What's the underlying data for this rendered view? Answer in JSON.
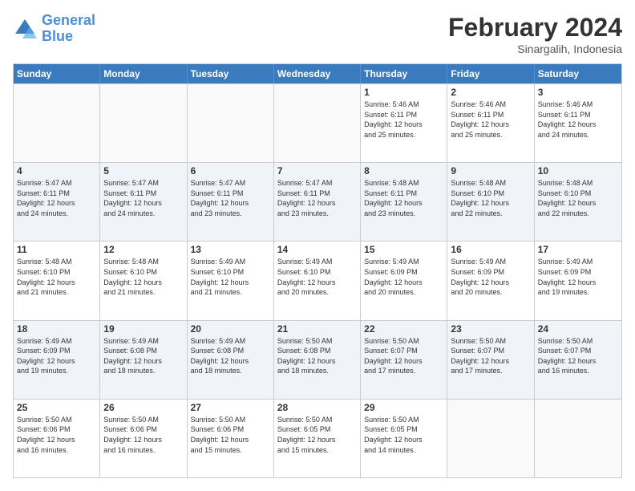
{
  "logo": {
    "text_general": "General",
    "text_blue": "Blue"
  },
  "header": {
    "month": "February 2024",
    "location": "Sinargalih, Indonesia"
  },
  "days_of_week": [
    "Sunday",
    "Monday",
    "Tuesday",
    "Wednesday",
    "Thursday",
    "Friday",
    "Saturday"
  ],
  "weeks": [
    {
      "alt": false,
      "cells": [
        {
          "day": "",
          "empty": true,
          "info": ""
        },
        {
          "day": "",
          "empty": true,
          "info": ""
        },
        {
          "day": "",
          "empty": true,
          "info": ""
        },
        {
          "day": "",
          "empty": true,
          "info": ""
        },
        {
          "day": "1",
          "empty": false,
          "info": "Sunrise: 5:46 AM\nSunset: 6:11 PM\nDaylight: 12 hours\nand 25 minutes."
        },
        {
          "day": "2",
          "empty": false,
          "info": "Sunrise: 5:46 AM\nSunset: 6:11 PM\nDaylight: 12 hours\nand 25 minutes."
        },
        {
          "day": "3",
          "empty": false,
          "info": "Sunrise: 5:46 AM\nSunset: 6:11 PM\nDaylight: 12 hours\nand 24 minutes."
        }
      ]
    },
    {
      "alt": true,
      "cells": [
        {
          "day": "4",
          "empty": false,
          "info": "Sunrise: 5:47 AM\nSunset: 6:11 PM\nDaylight: 12 hours\nand 24 minutes."
        },
        {
          "day": "5",
          "empty": false,
          "info": "Sunrise: 5:47 AM\nSunset: 6:11 PM\nDaylight: 12 hours\nand 24 minutes."
        },
        {
          "day": "6",
          "empty": false,
          "info": "Sunrise: 5:47 AM\nSunset: 6:11 PM\nDaylight: 12 hours\nand 23 minutes."
        },
        {
          "day": "7",
          "empty": false,
          "info": "Sunrise: 5:47 AM\nSunset: 6:11 PM\nDaylight: 12 hours\nand 23 minutes."
        },
        {
          "day": "8",
          "empty": false,
          "info": "Sunrise: 5:48 AM\nSunset: 6:11 PM\nDaylight: 12 hours\nand 23 minutes."
        },
        {
          "day": "9",
          "empty": false,
          "info": "Sunrise: 5:48 AM\nSunset: 6:10 PM\nDaylight: 12 hours\nand 22 minutes."
        },
        {
          "day": "10",
          "empty": false,
          "info": "Sunrise: 5:48 AM\nSunset: 6:10 PM\nDaylight: 12 hours\nand 22 minutes."
        }
      ]
    },
    {
      "alt": false,
      "cells": [
        {
          "day": "11",
          "empty": false,
          "info": "Sunrise: 5:48 AM\nSunset: 6:10 PM\nDaylight: 12 hours\nand 21 minutes."
        },
        {
          "day": "12",
          "empty": false,
          "info": "Sunrise: 5:48 AM\nSunset: 6:10 PM\nDaylight: 12 hours\nand 21 minutes."
        },
        {
          "day": "13",
          "empty": false,
          "info": "Sunrise: 5:49 AM\nSunset: 6:10 PM\nDaylight: 12 hours\nand 21 minutes."
        },
        {
          "day": "14",
          "empty": false,
          "info": "Sunrise: 5:49 AM\nSunset: 6:10 PM\nDaylight: 12 hours\nand 20 minutes."
        },
        {
          "day": "15",
          "empty": false,
          "info": "Sunrise: 5:49 AM\nSunset: 6:09 PM\nDaylight: 12 hours\nand 20 minutes."
        },
        {
          "day": "16",
          "empty": false,
          "info": "Sunrise: 5:49 AM\nSunset: 6:09 PM\nDaylight: 12 hours\nand 20 minutes."
        },
        {
          "day": "17",
          "empty": false,
          "info": "Sunrise: 5:49 AM\nSunset: 6:09 PM\nDaylight: 12 hours\nand 19 minutes."
        }
      ]
    },
    {
      "alt": true,
      "cells": [
        {
          "day": "18",
          "empty": false,
          "info": "Sunrise: 5:49 AM\nSunset: 6:09 PM\nDaylight: 12 hours\nand 19 minutes."
        },
        {
          "day": "19",
          "empty": false,
          "info": "Sunrise: 5:49 AM\nSunset: 6:08 PM\nDaylight: 12 hours\nand 18 minutes."
        },
        {
          "day": "20",
          "empty": false,
          "info": "Sunrise: 5:49 AM\nSunset: 6:08 PM\nDaylight: 12 hours\nand 18 minutes."
        },
        {
          "day": "21",
          "empty": false,
          "info": "Sunrise: 5:50 AM\nSunset: 6:08 PM\nDaylight: 12 hours\nand 18 minutes."
        },
        {
          "day": "22",
          "empty": false,
          "info": "Sunrise: 5:50 AM\nSunset: 6:07 PM\nDaylight: 12 hours\nand 17 minutes."
        },
        {
          "day": "23",
          "empty": false,
          "info": "Sunrise: 5:50 AM\nSunset: 6:07 PM\nDaylight: 12 hours\nand 17 minutes."
        },
        {
          "day": "24",
          "empty": false,
          "info": "Sunrise: 5:50 AM\nSunset: 6:07 PM\nDaylight: 12 hours\nand 16 minutes."
        }
      ]
    },
    {
      "alt": false,
      "cells": [
        {
          "day": "25",
          "empty": false,
          "info": "Sunrise: 5:50 AM\nSunset: 6:06 PM\nDaylight: 12 hours\nand 16 minutes."
        },
        {
          "day": "26",
          "empty": false,
          "info": "Sunrise: 5:50 AM\nSunset: 6:06 PM\nDaylight: 12 hours\nand 16 minutes."
        },
        {
          "day": "27",
          "empty": false,
          "info": "Sunrise: 5:50 AM\nSunset: 6:06 PM\nDaylight: 12 hours\nand 15 minutes."
        },
        {
          "day": "28",
          "empty": false,
          "info": "Sunrise: 5:50 AM\nSunset: 6:05 PM\nDaylight: 12 hours\nand 15 minutes."
        },
        {
          "day": "29",
          "empty": false,
          "info": "Sunrise: 5:50 AM\nSunset: 6:05 PM\nDaylight: 12 hours\nand 14 minutes."
        },
        {
          "day": "",
          "empty": true,
          "info": ""
        },
        {
          "day": "",
          "empty": true,
          "info": ""
        }
      ]
    }
  ]
}
